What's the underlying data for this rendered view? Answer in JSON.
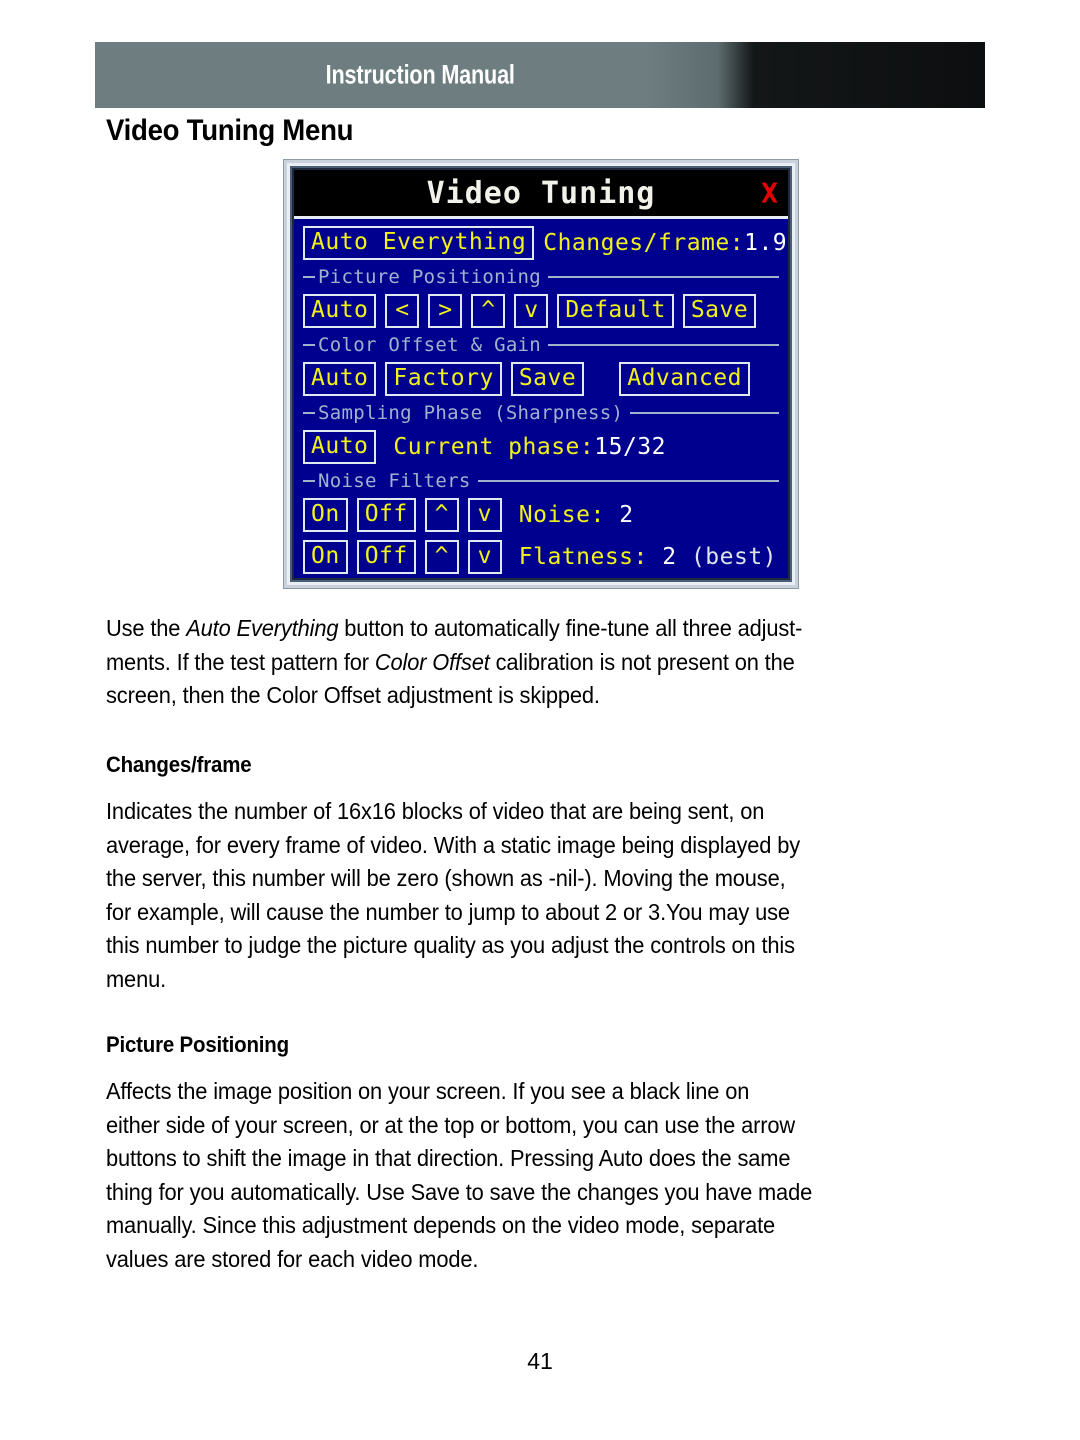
{
  "page": {
    "header_title": "Instruction Manual",
    "page_number": "41"
  },
  "sections": {
    "title": "Video Tuning Menu",
    "intro_lines": [
      "Use the <em>Auto Everything</em> button to automatically fine-tune all three adjust-",
      "ments. If the test pattern for <em>Color Offset</em> calibration is not present on the",
      "screen, then the Color Offset adjustment is skipped."
    ],
    "changes_frame_heading": "Changes/frame",
    "changes_frame_lines": [
      "Indicates the number of 16x16 blocks of video that are being sent, on",
      "average, for every frame of video.  With a static image being displayed by",
      "the server, this number will be zero (shown as -nil-). Moving the mouse,",
      "for example, will cause the number to jump to about 2 or 3.You may use",
      "this number to judge the picture quality as you adjust the controls on this",
      "menu."
    ],
    "picture_positioning_heading": "Picture Positioning",
    "picture_positioning_lines": [
      "Affects the image position on your screen. If you see a black line on",
      "either side of your screen, or at the top or bottom, you can use the arrow",
      "buttons to shift the image in that direction. Pressing Auto does the same",
      "thing for you automatically. Use Save to save the changes you have made",
      "manually. Since this adjustment depends on the video mode, separate",
      "values are stored for each video mode."
    ]
  },
  "osd": {
    "title": "Video Tuning",
    "close_label": "X",
    "auto_everything_button": "Auto Everything",
    "changes_frame_label": "Changes/frame:",
    "changes_frame_value": "1.90",
    "groups": {
      "picture_positioning": {
        "label": "Picture Positioning",
        "buttons": [
          "Auto",
          "<",
          ">",
          "^",
          "v",
          "Default",
          "Save"
        ]
      },
      "color_offset_gain": {
        "label": "Color Offset & Gain",
        "buttons": [
          "Auto",
          "Factory",
          "Save",
          "Advanced"
        ]
      },
      "sampling_phase": {
        "label": "Sampling Phase (Sharpness)",
        "auto_button": "Auto",
        "phase_label": "Current phase:",
        "phase_value": "15/32"
      },
      "noise_filters": {
        "label": "Noise Filters",
        "rows": [
          {
            "on": "On",
            "off": "Off",
            "up": "^",
            "down": "v",
            "label": "Noise: ",
            "value": "2",
            "note": ""
          },
          {
            "on": "On",
            "off": "Off",
            "up": "^",
            "down": "v",
            "label": "Flatness: ",
            "value": "2",
            "note": " (best)"
          }
        ]
      }
    }
  },
  "colors": {
    "osd_background": "#00008f",
    "osd_text_yellow": "#f2f21a",
    "osd_text_white": "#ffffff",
    "osd_group_label": "#9fb4cc",
    "osd_close_red": "#e60000",
    "header_band": "#6e7e80"
  }
}
